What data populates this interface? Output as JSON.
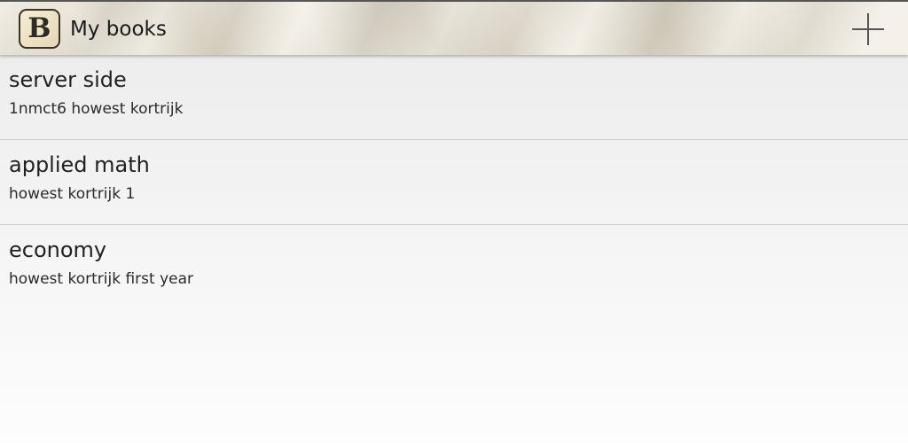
{
  "action_bar": {
    "title": "My books",
    "app_icon": {
      "name": "app-logo-icon",
      "letter": "B"
    },
    "add_icon": "plus-icon"
  },
  "books": [
    {
      "title": "server side",
      "subtitle": "1nmct6 howest kortrijk"
    },
    {
      "title": "applied math",
      "subtitle": "howest kortrijk 1"
    },
    {
      "title": "economy",
      "subtitle": "howest kortrijk first year"
    }
  ],
  "colors": {
    "action_bar_bg": "#e4ddcb",
    "divider": "#cfcfcf",
    "text_primary": "#222222"
  }
}
